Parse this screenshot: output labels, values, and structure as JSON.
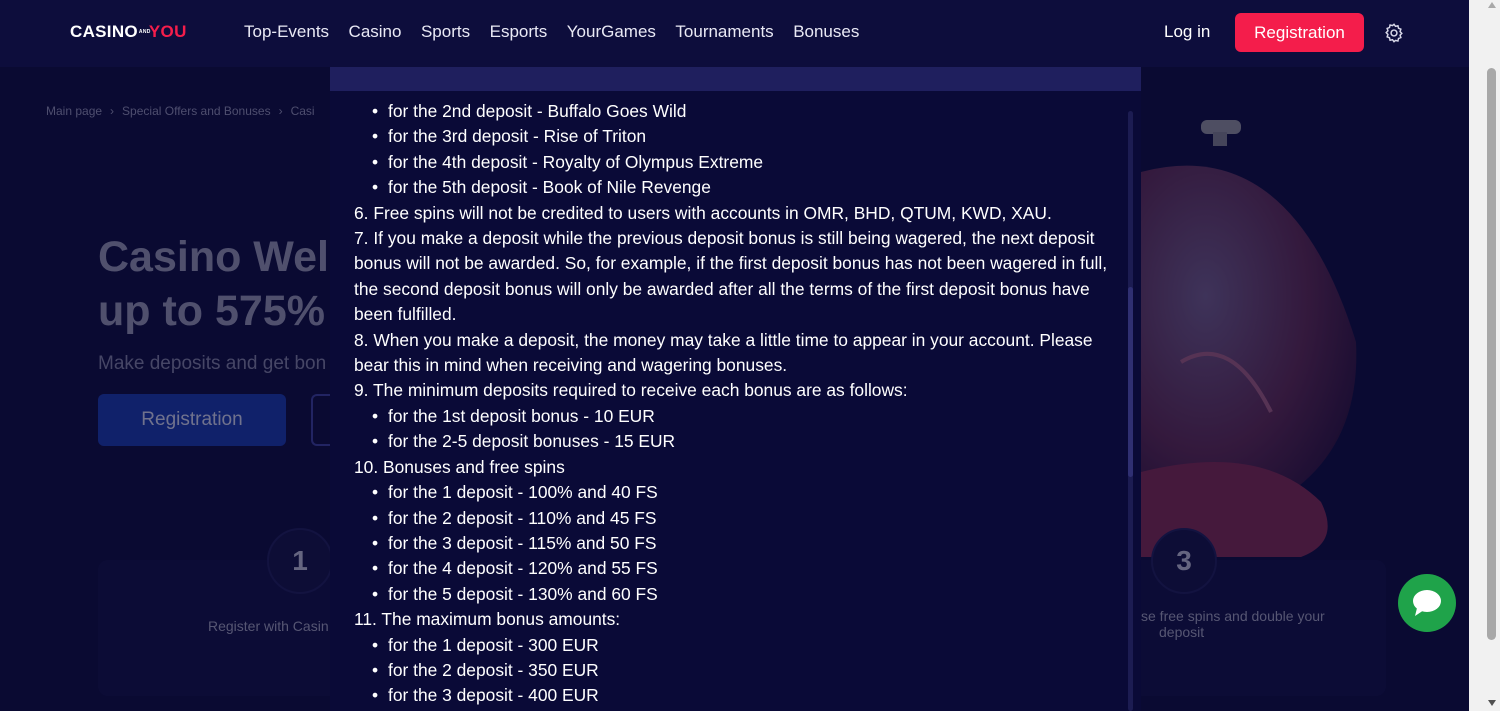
{
  "header": {
    "logo_left": "CASINO",
    "logo_and": "AND",
    "logo_right": "YOU",
    "nav": [
      "Top-Events",
      "Casino",
      "Sports",
      "Esports",
      "YourGames",
      "Tournaments",
      "Bonuses"
    ],
    "login": "Log in",
    "registration": "Registration"
  },
  "background": {
    "breadcrumbs": [
      "Main page",
      "Special Offers and Bonuses",
      "Casi"
    ],
    "hero_title_line1": "Casino Welc",
    "hero_title_line2": "up to 575%",
    "hero_subtitle": "Make deposits and get bon",
    "hero_registration": "Registration",
    "step1_number": "1",
    "step1_text": "Register with Casin",
    "step3_number": "3",
    "step3_text_line1": "se free spins and double your",
    "step3_text_line2": "deposit"
  },
  "terms": {
    "lines": [
      {
        "type": "bullet",
        "text": "for the 2nd deposit - Buffalo Goes Wild"
      },
      {
        "type": "bullet",
        "text": "for the 3rd deposit - Rise of Triton"
      },
      {
        "type": "bullet",
        "text": "for the 4th deposit - Royalty of Olympus Extreme"
      },
      {
        "type": "bullet",
        "text": "for the 5th deposit - Book of Nile Revenge"
      },
      {
        "type": "item",
        "text": "6. Free spins will not be credited to users with accounts in OMR, BHD, QTUM, KWD, XAU."
      },
      {
        "type": "item",
        "text": "7. If you make a deposit while the previous deposit bonus is still being wagered, the next deposit bonus will not be awarded. So, for example, if the first deposit bonus has not been wagered in full, the second deposit bonus will only be awarded after all the terms of the first deposit bonus have been fulfilled."
      },
      {
        "type": "item",
        "text": "8. When you make a deposit, the money may take a little time to appear in your account. Please bear this in mind when receiving and wagering bonuses."
      },
      {
        "type": "item",
        "text": "9. The minimum deposits required to receive each bonus are as follows:"
      },
      {
        "type": "bullet",
        "text": "for the 1st deposit bonus - 10 EUR"
      },
      {
        "type": "bullet",
        "text": "for the 2-5 deposit bonuses - 15 EUR"
      },
      {
        "type": "item",
        "text": "10. Bonuses and free spins"
      },
      {
        "type": "bullet",
        "text": "for the 1 deposit - 100% and 40 FS"
      },
      {
        "type": "bullet",
        "text": "for the 2 deposit - 110% and 45 FS"
      },
      {
        "type": "bullet",
        "text": "for the 3 deposit - 115% and 50 FS"
      },
      {
        "type": "bullet",
        "text": "for the 4 deposit - 120% and 55 FS"
      },
      {
        "type": "bullet",
        "text": "for the 5 deposit - 130% and 60 FS"
      },
      {
        "type": "item",
        "text": "11. The maximum bonus amounts:"
      },
      {
        "type": "bullet",
        "text": "for the 1 deposit - 300 EUR"
      },
      {
        "type": "bullet",
        "text": "for the 2 deposit - 350 EUR"
      },
      {
        "type": "bullet",
        "text": "for the 3 deposit - 400 EUR"
      }
    ]
  },
  "colors": {
    "accent": "#f41d4b",
    "chat": "#1fa34a",
    "background": "#0b0b35"
  }
}
